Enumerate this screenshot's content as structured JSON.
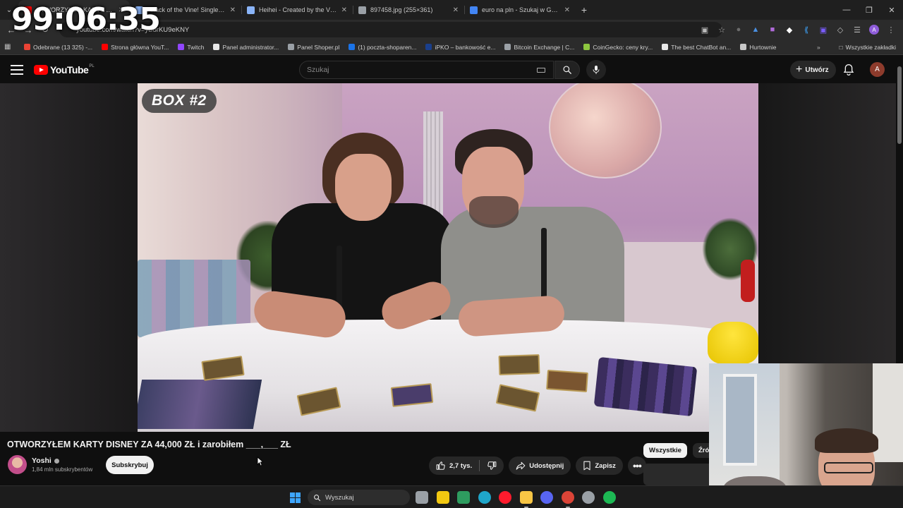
{
  "timer": "99:06:35",
  "browser": {
    "tabs": [
      {
        "title": "OTWORZYŁEM KARTY DISNEY",
        "active": true,
        "favicon_color": "#ff0000"
      },
      {
        "title": "Attack of the Vine! Singles | Ca",
        "active": false,
        "favicon_color": "#8ab4f8"
      },
      {
        "title": "Heihei - Created by the Vine (V",
        "active": false,
        "favicon_color": "#8ab4f8"
      },
      {
        "title": "897458.jpg (255×361)",
        "active": false,
        "favicon_color": "#9aa0a6"
      },
      {
        "title": "euro na pln - Szukaj w Google",
        "active": false,
        "favicon_color": "#4285f4"
      }
    ],
    "url": "youtube.com/watch?v=yB8rKU9eKNY",
    "bookmarks": [
      {
        "label": "Odebrane (13 325) -...",
        "color": "#ea4335"
      },
      {
        "label": "Strona główna YouT...",
        "color": "#ff0000"
      },
      {
        "label": "Twitch",
        "color": "#9146ff"
      },
      {
        "label": "Panel administrator...",
        "color": "#e8e8e8"
      },
      {
        "label": "Panel Shoper.pl",
        "color": "#9aa0a6"
      },
      {
        "label": "(1) poczta-shoparen...",
        "color": "#1a73e8"
      },
      {
        "label": "iPKO – bankowość e...",
        "color": "#1a3f8c"
      },
      {
        "label": "Bitcoin Exchange | C...",
        "color": "#9aa0a6"
      },
      {
        "label": "CoinGecko: ceny kry...",
        "color": "#8dc63f"
      },
      {
        "label": "The best ChatBot an...",
        "color": "#e8e8e8"
      },
      {
        "label": "Hurtownie",
        "color": "#c7c7c7"
      }
    ],
    "all_bookmarks": "Wszystkie zakładki",
    "profile_initial": "A"
  },
  "youtube": {
    "logo_text": "YouTube",
    "region": "PL",
    "search_placeholder": "Szukaj",
    "create_label": "Utwórz",
    "avatar_initial": "A",
    "video_overlay_text": "BOX #2",
    "video_title": "OTWORZYŁEM KARTY DISNEY ZA 44,000 ZŁ i zarobiłem ___,___ ZŁ",
    "channel": {
      "name": "Yoshi",
      "subscribers": "1,84 mln subskrybentów",
      "subscribe_label": "Subskrybuj"
    },
    "actions": {
      "likes": "2,7 tys.",
      "share": "Udostępnij",
      "save": "Zapisz"
    },
    "chips": [
      "Wszystkie",
      "Źródło"
    ]
  },
  "taskbar": {
    "search_placeholder": "Wyszukaj",
    "apps": [
      {
        "name": "task-view",
        "color": "#9aa0a6"
      },
      {
        "name": "store",
        "color": "#f2c811"
      },
      {
        "name": "notepad",
        "color": "#2e9c5f"
      },
      {
        "name": "edge",
        "color": "#1fa5c9"
      },
      {
        "name": "opera",
        "color": "#ff1b2d"
      },
      {
        "name": "explorer",
        "color": "#f8c645"
      },
      {
        "name": "discord",
        "color": "#5865f2"
      },
      {
        "name": "chrome",
        "color": "#db4437"
      },
      {
        "name": "steam",
        "color": "#9aa0a6"
      },
      {
        "name": "spotify",
        "color": "#1db954"
      }
    ]
  }
}
